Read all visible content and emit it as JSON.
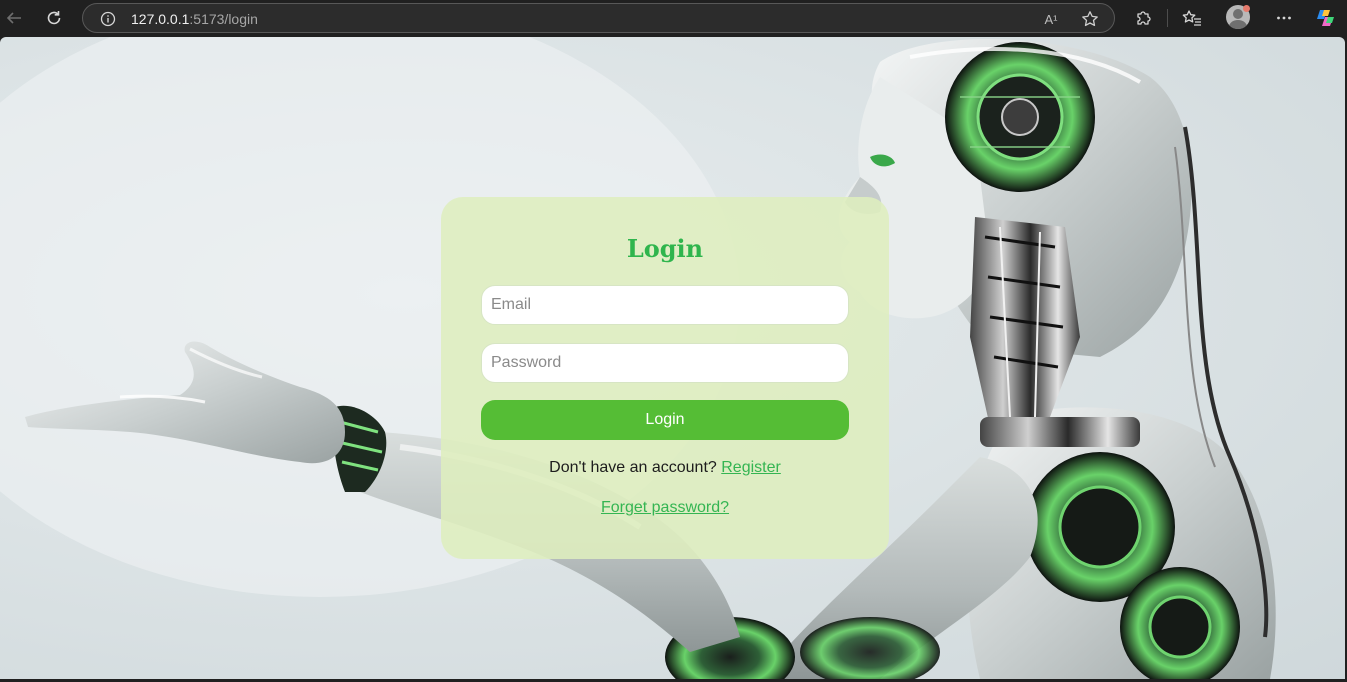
{
  "browser": {
    "url_host": "127.0.0.1",
    "url_path": ":5173/login",
    "read_aloud_label": "A¹"
  },
  "login": {
    "title": "Login",
    "email_placeholder": "Email",
    "password_placeholder": "Password",
    "submit_label": "Login",
    "register_prompt": "Don't have an account?",
    "register_link": "Register",
    "forgot_link": "Forget password?"
  },
  "colors": {
    "accent_green": "#2fb54d",
    "button_green": "#55bd35",
    "card_bg": "#deeebe"
  }
}
